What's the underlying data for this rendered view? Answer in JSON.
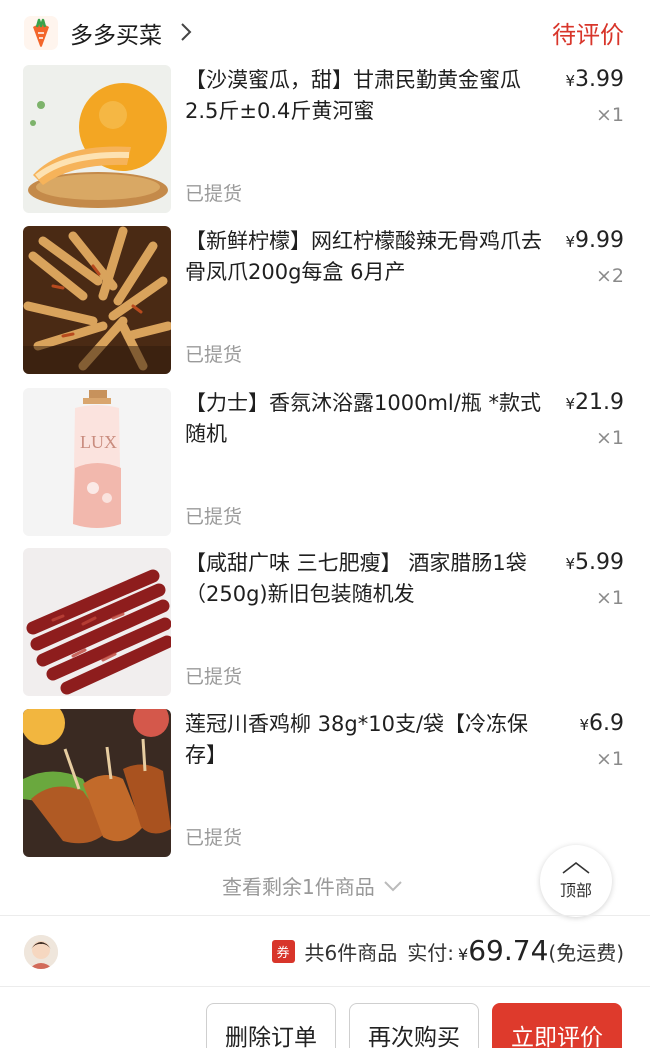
{
  "store": {
    "name": "多多买菜",
    "logo_icon": "carrot-logo-icon",
    "status": "待评价"
  },
  "items": [
    {
      "title": "【沙漠蜜瓜，甜】甘肃民勤黄金蜜瓜2.5斤±0.4斤黄河蜜",
      "currency": "¥",
      "price": "3.99",
      "qty": "×1",
      "pick": "已提货",
      "image": "melon"
    },
    {
      "title": "【新鲜柠檬】网红柠檬酸辣无骨鸡爪去骨凤爪200g每盒 6月产",
      "currency": "¥",
      "price": "9.99",
      "qty": "×2",
      "pick": "已提货",
      "image": "chicken-feet"
    },
    {
      "title": "【力士】香氛沐浴露1000ml/瓶 *款式随机",
      "currency": "¥",
      "price": "21.9",
      "qty": "×1",
      "pick": "已提货",
      "image": "lux-bottle"
    },
    {
      "title": "【咸甜广味 三七肥瘦】 酒家腊肠1袋 （250g)新旧包装随机发",
      "currency": "¥",
      "price": "5.99",
      "qty": "×1",
      "pick": "已提货",
      "image": "sausage"
    },
    {
      "title": "莲冠川香鸡柳 38g*10支/袋【冷冻保存】",
      "currency": "¥",
      "price": "6.9",
      "qty": "×1",
      "pick": "已提货",
      "image": "chicken-strips"
    }
  ],
  "more": {
    "label": "查看剩余1件商品"
  },
  "top_button": {
    "label": "顶部"
  },
  "summary": {
    "coupon": "券",
    "count_text": "共6件商品",
    "paid_label": "实付:",
    "currency": "¥",
    "amount": "69.74",
    "shipping": "(免运费)"
  },
  "actions": {
    "delete": "删除订单",
    "rebuy": "再次购买",
    "review": "立即评价"
  },
  "colors": {
    "accent": "#d8352a",
    "muted": "#999999"
  },
  "product_image_text": {
    "lux_brand": "LUX"
  }
}
